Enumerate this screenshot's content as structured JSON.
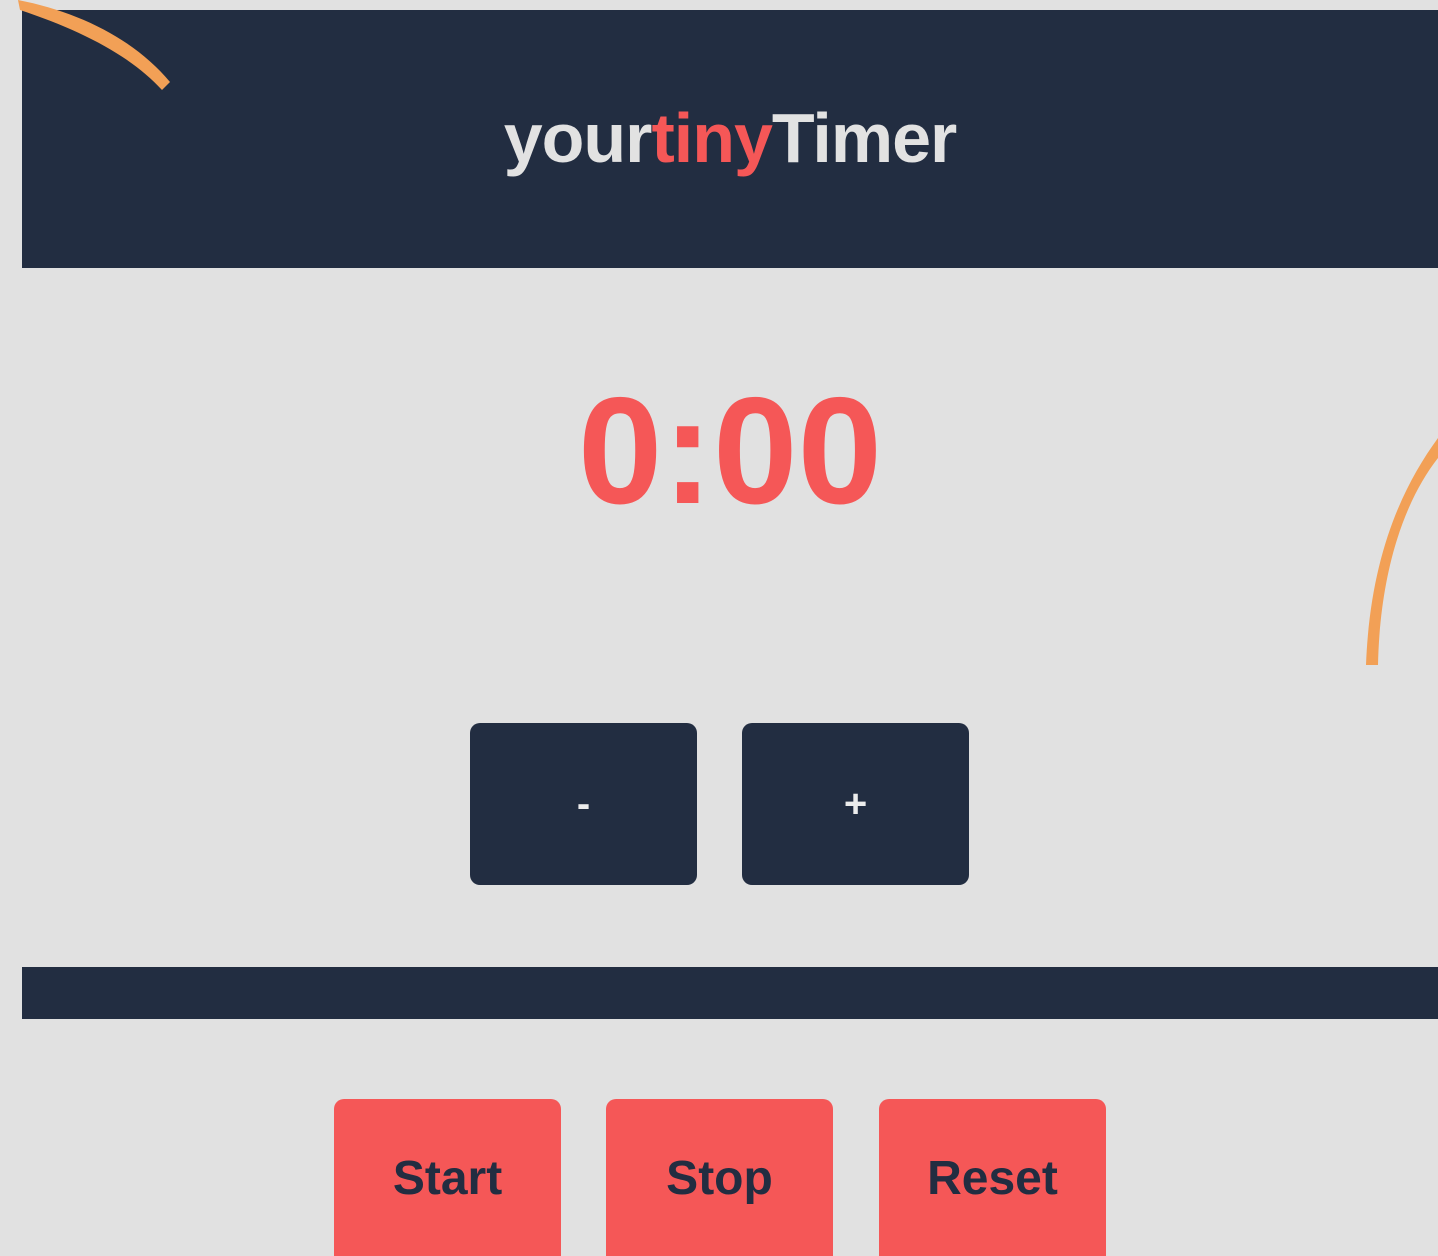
{
  "header": {
    "logo_part1": "your",
    "logo_part2": "tiny",
    "logo_part3": "Timer"
  },
  "timer": {
    "display": "0:00"
  },
  "adjust": {
    "decrement_label": "-",
    "increment_label": "+"
  },
  "controls": {
    "start_label": "Start",
    "stop_label": "Stop",
    "reset_label": "Reset"
  },
  "colors": {
    "navy": "#222d41",
    "accent": "#f55757",
    "background": "#e1e1e1",
    "decoration": "#f2a056",
    "logo_light": "#e2e2e2"
  }
}
